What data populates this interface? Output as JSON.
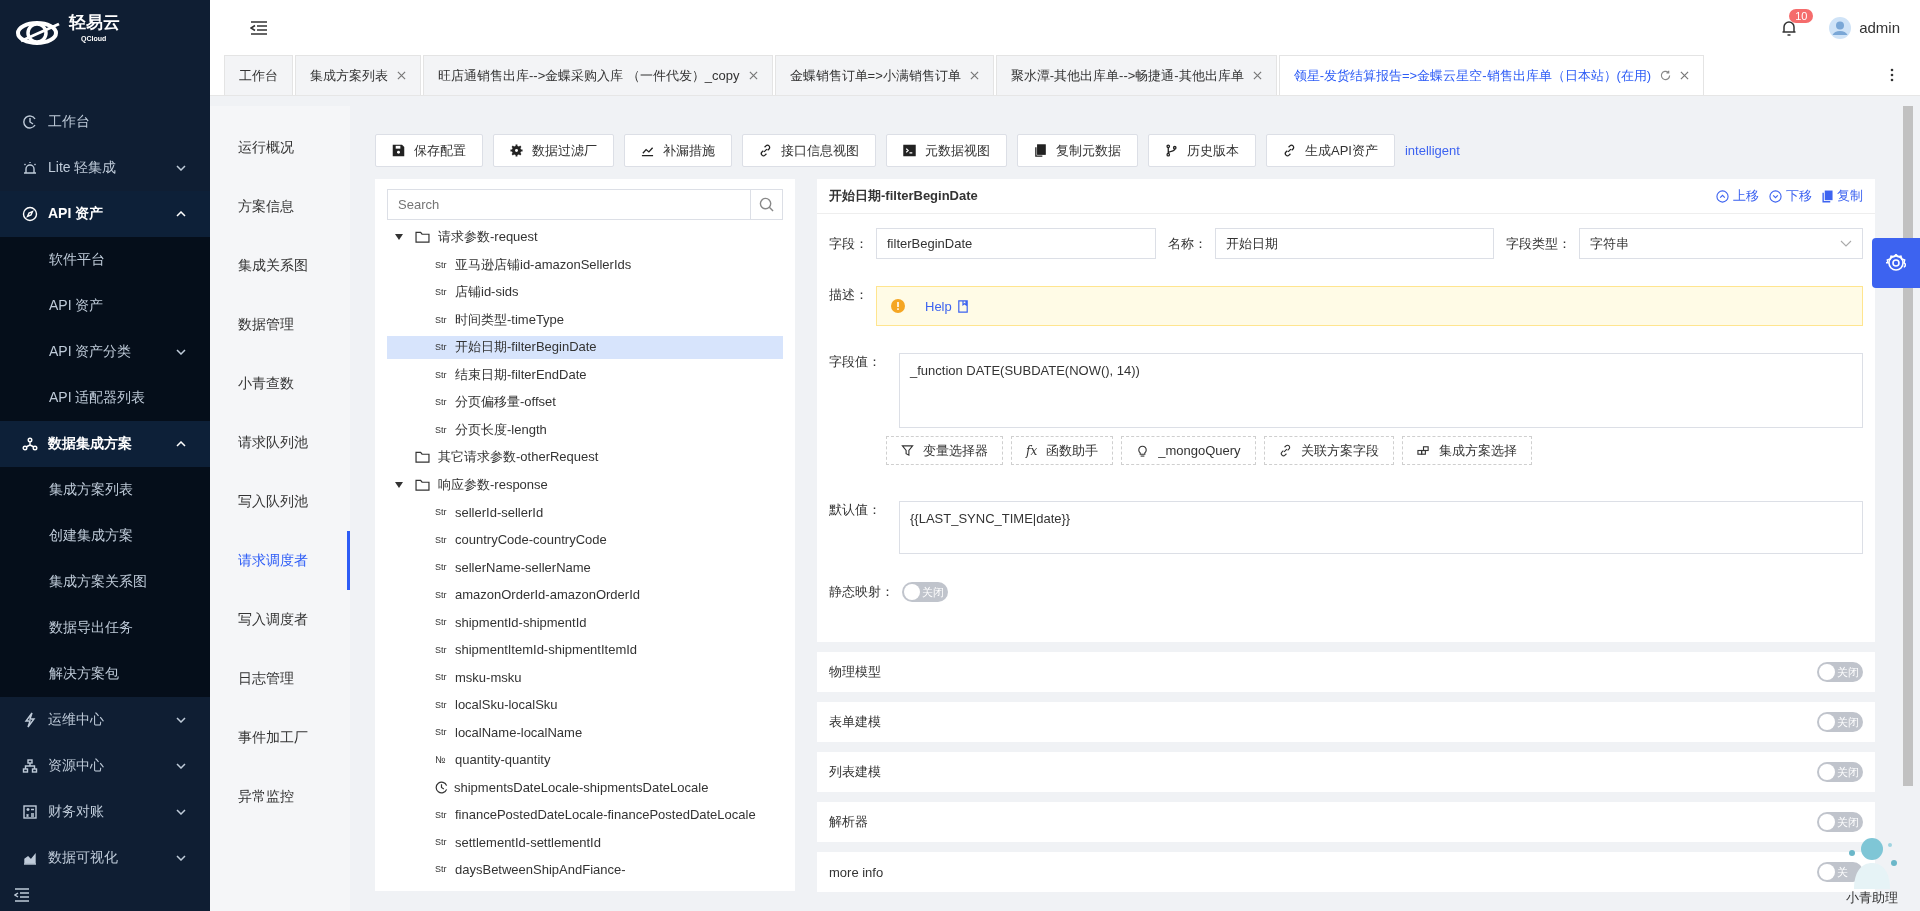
{
  "sidebar": {
    "logo_text": "轻易云",
    "logo_sub": "QCloud",
    "menu": [
      {
        "label": "工作台",
        "kind": "item"
      },
      {
        "label": "Lite 轻集成",
        "kind": "group",
        "expanded": false
      },
      {
        "label": "API 资产",
        "kind": "group",
        "expanded": true,
        "children": [
          {
            "label": "软件平台",
            "kind": "item"
          },
          {
            "label": "API 资产",
            "kind": "item"
          },
          {
            "label": "API 资产分类",
            "kind": "group",
            "expanded": false
          },
          {
            "label": "API 适配器列表",
            "kind": "item"
          }
        ]
      },
      {
        "label": "数据集成方案",
        "kind": "group",
        "expanded": true,
        "children": [
          {
            "label": "集成方案列表",
            "kind": "item"
          },
          {
            "label": "创建集成方案",
            "kind": "item"
          },
          {
            "label": "集成方案关系图",
            "kind": "item"
          },
          {
            "label": "数据导出任务",
            "kind": "item"
          },
          {
            "label": "解决方案包",
            "kind": "item"
          }
        ]
      },
      {
        "label": "运维中心",
        "kind": "group",
        "expanded": false
      },
      {
        "label": "资源中心",
        "kind": "group",
        "expanded": false
      },
      {
        "label": "财务对账",
        "kind": "group",
        "expanded": false
      },
      {
        "label": "数据可视化",
        "kind": "group",
        "expanded": false
      }
    ]
  },
  "header": {
    "notifications": "10",
    "user": "admin"
  },
  "tabs": [
    {
      "label": "工作台",
      "closable": false,
      "selected": false
    },
    {
      "label": "集成方案列表",
      "closable": true,
      "selected": false
    },
    {
      "label": "旺店通销售出库-->金蝶采购入库 （一件代发）_copy",
      "closable": true,
      "selected": false
    },
    {
      "label": "金蝶销售订单=>小满销售订单",
      "closable": true,
      "selected": false
    },
    {
      "label": "聚水潭-其他出库单-->畅捷通-其他出库单",
      "closable": true,
      "selected": false
    },
    {
      "label": "领星-发货结算报告=>金蝶云星空-销售出库单（日本站）(在用)",
      "closable": true,
      "selected": true
    }
  ],
  "subnav": [
    {
      "label": "运行概况",
      "selected": false
    },
    {
      "label": "方案信息",
      "selected": false
    },
    {
      "label": "集成关系图",
      "selected": false
    },
    {
      "label": "数据管理",
      "selected": false
    },
    {
      "label": "小青查数",
      "selected": false
    },
    {
      "label": "请求队列池",
      "selected": false
    },
    {
      "label": "写入队列池",
      "selected": false
    },
    {
      "label": "请求调度者",
      "selected": true
    },
    {
      "label": "写入调度者",
      "selected": false
    },
    {
      "label": "日志管理",
      "selected": false
    },
    {
      "label": "事件加工厂",
      "selected": false
    },
    {
      "label": "异常监控",
      "selected": false
    }
  ],
  "toolbar": {
    "buttons": [
      {
        "label": "保存配置",
        "kind": "save"
      },
      {
        "label": "数据过滤厂",
        "kind": "gear"
      },
      {
        "label": "补漏措施",
        "kind": "chart"
      },
      {
        "label": "接口信息视图",
        "kind": "link"
      },
      {
        "label": "元数据视图",
        "kind": "terminal"
      },
      {
        "label": "复制元数据",
        "kind": "copy"
      },
      {
        "label": "历史版本",
        "kind": "branch"
      },
      {
        "label": "生成API资产",
        "kind": "link"
      }
    ],
    "link": "intelligent"
  },
  "tree": {
    "search": {
      "placeholder": "Search"
    },
    "nodes": [
      {
        "label": "请求参数-request",
        "kind": "folder",
        "expanded": true,
        "children": [
          {
            "label": "亚马逊店铺id-amazonSellerIds",
            "kind": "str",
            "tag": "Str",
            "selected": false
          },
          {
            "label": "店铺id-sids",
            "kind": "str",
            "tag": "Str",
            "selected": false
          },
          {
            "label": "时间类型-timeType",
            "kind": "str",
            "tag": "Str",
            "selected": false
          },
          {
            "label": "开始日期-filterBeginDate",
            "kind": "str",
            "tag": "Str",
            "selected": true
          },
          {
            "label": "结束日期-filterEndDate",
            "kind": "str",
            "tag": "Str",
            "selected": false
          },
          {
            "label": "分页偏移量-offset",
            "kind": "str",
            "tag": "Str",
            "selected": false
          },
          {
            "label": "分页长度-length",
            "kind": "str",
            "tag": "Str",
            "selected": false
          }
        ]
      },
      {
        "label": "其它请求参数-otherRequest",
        "kind": "folder",
        "expanded": false
      },
      {
        "label": "响应参数-response",
        "kind": "folder",
        "expanded": true,
        "children": [
          {
            "label": "sellerId-sellerId",
            "kind": "str",
            "tag": "Str",
            "selected": false
          },
          {
            "label": "countryCode-countryCode",
            "kind": "str",
            "tag": "Str",
            "selected": false
          },
          {
            "label": "sellerName-sellerName",
            "kind": "str",
            "tag": "Str",
            "selected": false
          },
          {
            "label": "amazonOrderId-amazonOrderId",
            "kind": "str",
            "tag": "Str",
            "selected": false
          },
          {
            "label": "shipmentId-shipmentId",
            "kind": "str",
            "tag": "Str",
            "selected": false
          },
          {
            "label": "shipmentItemId-shipmentItemId",
            "kind": "str",
            "tag": "Str",
            "selected": false
          },
          {
            "label": "msku-msku",
            "kind": "str",
            "tag": "Str",
            "selected": false
          },
          {
            "label": "localSku-localSku",
            "kind": "str",
            "tag": "Str",
            "selected": false
          },
          {
            "label": "localName-localName",
            "kind": "str",
            "tag": "Str",
            "selected": false
          },
          {
            "label": "quantity-quantity",
            "kind": "num",
            "tag": "№",
            "selected": false
          },
          {
            "label": "shipmentsDateLocale-shipmentsDateLocale",
            "kind": "date",
            "selected": false
          },
          {
            "label": "financePostedDateLocale-financePostedDateLocale",
            "kind": "str",
            "tag": "Str",
            "selected": false
          },
          {
            "label": "settlementId-settlementId",
            "kind": "str",
            "tag": "Str",
            "selected": false
          },
          {
            "label": "daysBetweenShipAndFiance-",
            "kind": "str",
            "tag": "Str",
            "selected": false
          }
        ]
      }
    ]
  },
  "detail": {
    "title": "开始日期-filterBeginDate",
    "actions": [
      {
        "label": "上移",
        "kind": "up"
      },
      {
        "label": "下移",
        "kind": "down"
      },
      {
        "label": "复制",
        "kind": "copy"
      }
    ],
    "fields": [
      {
        "label": "字段：",
        "value": "filterBeginDate",
        "kind": "input"
      },
      {
        "label": "名称：",
        "value": "开始日期",
        "kind": "input"
      },
      {
        "label": "字段类型：",
        "value": "字符串",
        "kind": "select"
      }
    ],
    "description": {
      "label": "描述：",
      "link": "Help"
    },
    "value_field": {
      "label": "字段值：",
      "value": "_function DATE(SUBDATE(NOW(), 14))"
    },
    "helpers": [
      {
        "label": "变量选择器",
        "kind": "filter"
      },
      {
        "label": "函数助手",
        "kind": "text",
        "prefix": "fx"
      },
      {
        "label": "_mongoQuery",
        "kind": "bulb"
      },
      {
        "label": "关联方案字段",
        "kind": "link"
      },
      {
        "label": "集成方案选择",
        "kind": "blocks"
      }
    ],
    "default_field": {
      "label": "默认值：",
      "value": "{{LAST_SYNC_TIME|date}}"
    },
    "static_mapping": {
      "label": "静态映射：",
      "on": false,
      "toggle_label": "关闭"
    }
  },
  "sections": [
    {
      "title": "物理模型",
      "on": false,
      "toggle_label": "关闭"
    },
    {
      "title": "表单建模",
      "on": false,
      "toggle_label": "关闭"
    },
    {
      "title": "列表建模",
      "on": false,
      "toggle_label": "关闭"
    },
    {
      "title": "解析器",
      "on": false,
      "toggle_label": "关闭"
    },
    {
      "title": "more info",
      "on": false,
      "toggle_label": "关"
    }
  ],
  "assistant": {
    "label": "小青助理"
  }
}
